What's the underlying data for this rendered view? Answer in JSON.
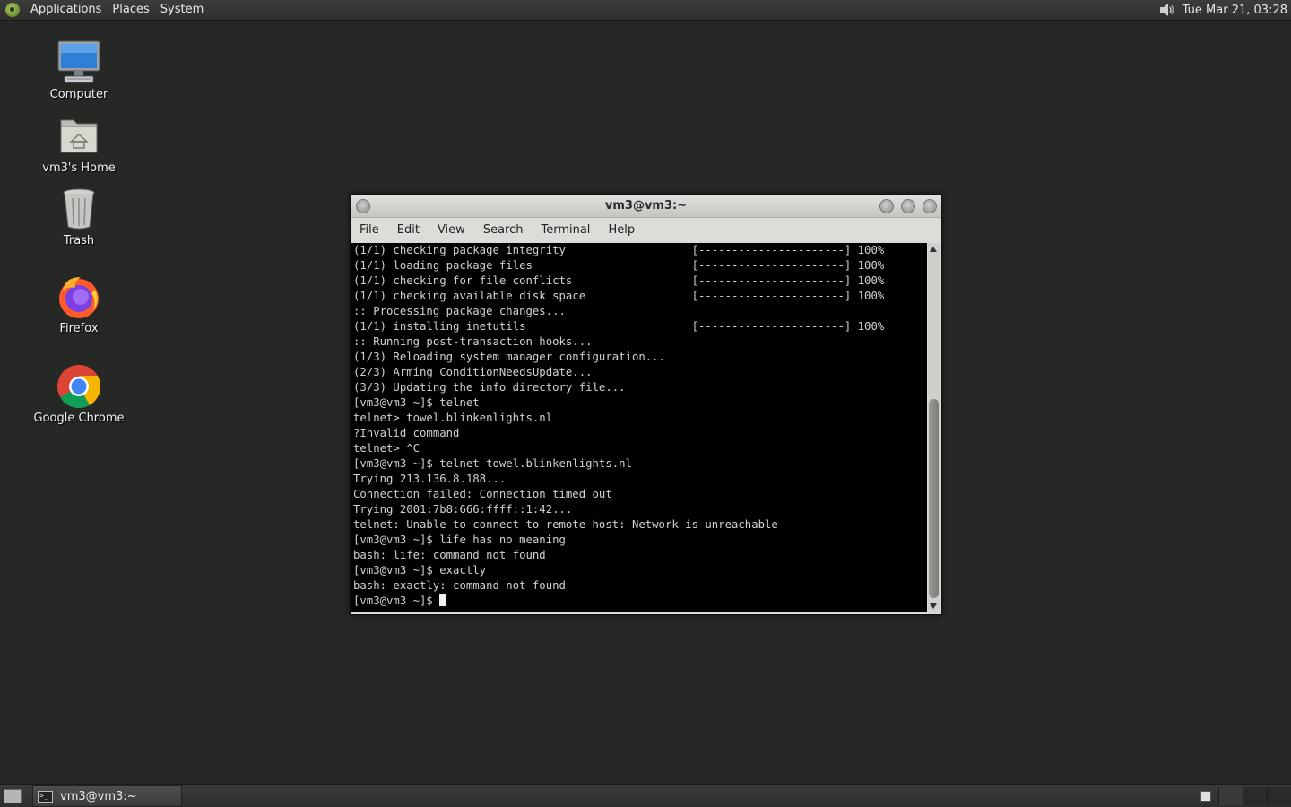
{
  "top_panel": {
    "menus": [
      "Applications",
      "Places",
      "System"
    ],
    "clock": "Tue Mar 21, 03:28",
    "volume_icon": "speaker-icon"
  },
  "desktop_icons": [
    {
      "label": "Computer",
      "icon": "computer-icon"
    },
    {
      "label": "vm3's Home",
      "icon": "home-folder-icon"
    },
    {
      "label": "Trash",
      "icon": "trash-icon"
    },
    {
      "label": "Firefox",
      "icon": "firefox-icon"
    },
    {
      "label": "Google Chrome",
      "icon": "chrome-icon"
    }
  ],
  "terminal": {
    "title": "vm3@vm3:~",
    "menu": [
      "File",
      "Edit",
      "View",
      "Search",
      "Terminal",
      "Help"
    ],
    "lines": [
      "(1/1) checking package integrity                   [----------------------] 100%",
      "(1/1) loading package files                        [----------------------] 100%",
      "(1/1) checking for file conflicts                  [----------------------] 100%",
      "(1/1) checking available disk space                [----------------------] 100%",
      ":: Processing package changes...",
      "(1/1) installing inetutils                         [----------------------] 100%",
      ":: Running post-transaction hooks...",
      "(1/3) Reloading system manager configuration...",
      "(2/3) Arming ConditionNeedsUpdate...",
      "(3/3) Updating the info directory file...",
      "[vm3@vm3 ~]$ telnet",
      "telnet> towel.blinkenlights.nl",
      "?Invalid command",
      "telnet> ^C",
      "[vm3@vm3 ~]$ telnet towel.blinkenlights.nl",
      "Trying 213.136.8.188...",
      "Connection failed: Connection timed out",
      "Trying 2001:7b8:666:ffff::1:42...",
      "telnet: Unable to connect to remote host: Network is unreachable",
      "[vm3@vm3 ~]$ life has no meaning",
      "bash: life: command not found",
      "[vm3@vm3 ~]$ exactly",
      "bash: exactly: command not found"
    ],
    "prompt": "[vm3@vm3 ~]$ "
  },
  "bottom_panel": {
    "task_label": "vm3@vm3:~"
  },
  "colors": {
    "desktop_bg": "#252825",
    "terminal_bg": "#000000",
    "terminal_fg": "#d2d2d2",
    "panel_bg": "#2e2f2d"
  }
}
